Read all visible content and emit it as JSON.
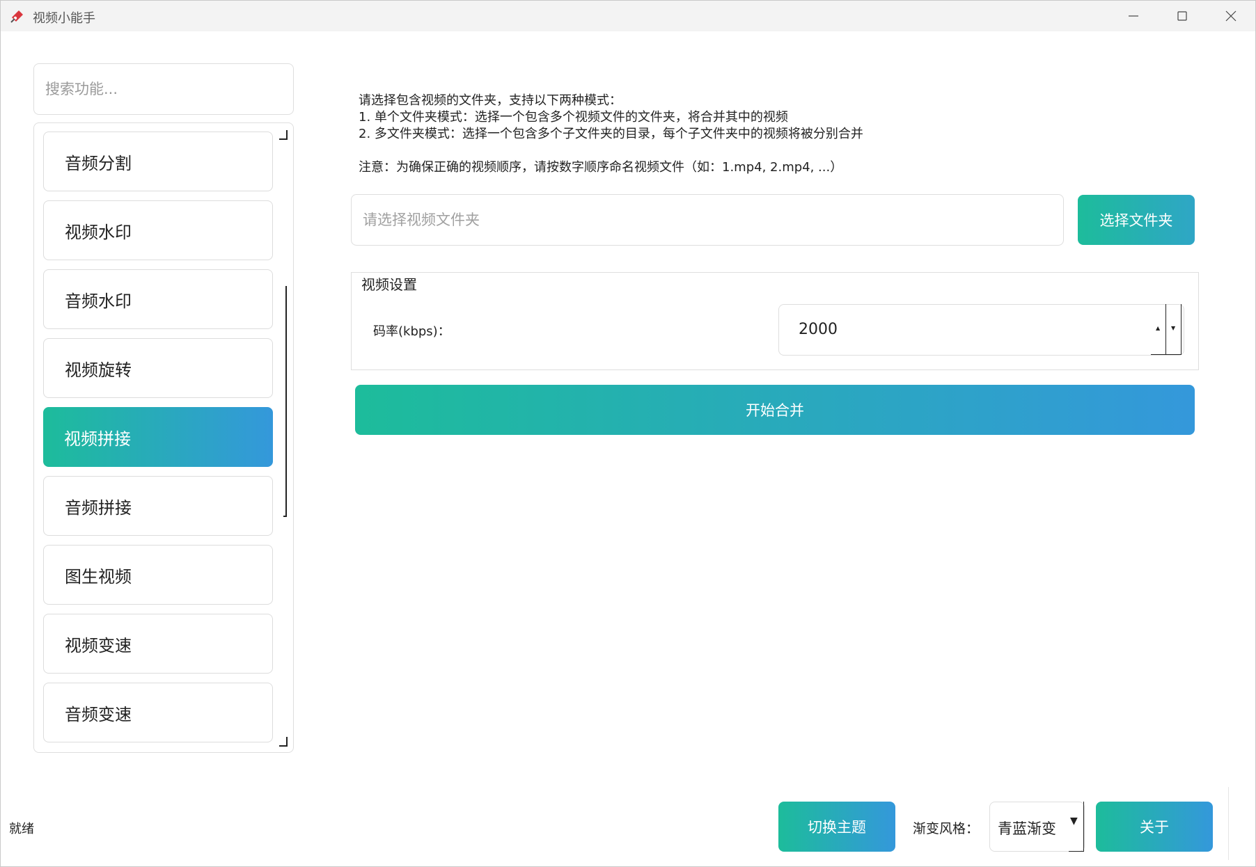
{
  "window": {
    "title": "视频小能手",
    "icon": "app-logo-icon",
    "controls": [
      "minimize-icon",
      "maximize-icon",
      "close-icon"
    ]
  },
  "sidebar": {
    "search_placeholder": "搜索功能...",
    "items": [
      {
        "label": "音频分割",
        "active": false
      },
      {
        "label": "视频水印",
        "active": false
      },
      {
        "label": "音频水印",
        "active": false
      },
      {
        "label": "视频旋转",
        "active": false
      },
      {
        "label": "视频拼接",
        "active": true
      },
      {
        "label": "音频拼接",
        "active": false
      },
      {
        "label": "图生视频",
        "active": false
      },
      {
        "label": "视频变速",
        "active": false
      },
      {
        "label": "音频变速",
        "active": false
      }
    ]
  },
  "main": {
    "instructions": "请选择包含视频的文件夹，支持以下两种模式：\n1. 单个文件夹模式：选择一个包含多个视频文件的文件夹，将合并其中的视频\n2. 多文件夹模式：选择一个包含多个子文件夹的目录，每个子文件夹中的视频将被分别合并\n\n注意：为确保正确的视频顺序，请按数字顺序命名视频文件（如：1.mp4, 2.mp4, ...）",
    "folder_placeholder": "请选择视频文件夹",
    "folder_value": "",
    "select_folder_button": "选择文件夹",
    "settings_group_title": "视频设置",
    "bitrate_label": "码率(kbps)：",
    "bitrate_value": "2000",
    "start_button": "开始合并"
  },
  "bottom": {
    "status": "就绪",
    "switch_theme_button": "切换主题",
    "gradient_style_label": "渐变风格：",
    "gradient_style_value": "青蓝渐变",
    "about_button": "关于"
  },
  "colors": {
    "gradient_start": "#1dbc9b",
    "gradient_end": "#3498db",
    "titlebar_bg": "#f3f3f3",
    "border": "#dedede"
  }
}
